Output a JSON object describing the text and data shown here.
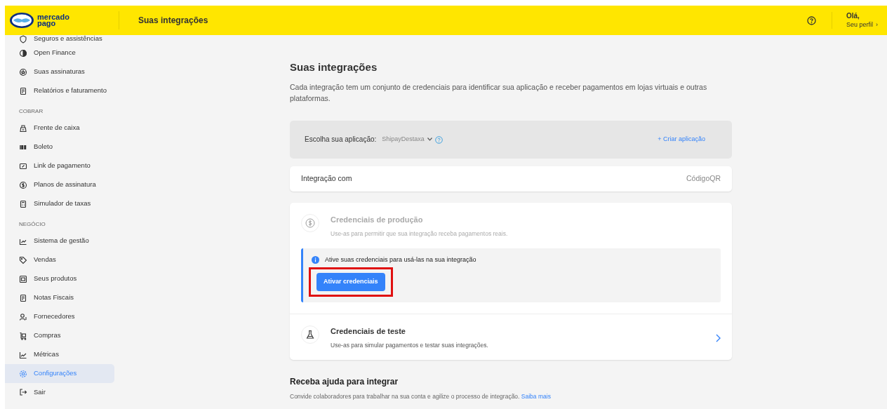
{
  "header": {
    "logo_line1": "mercado",
    "logo_line2": "pago",
    "title": "Suas integrações",
    "greeting": "Olá,",
    "profile_link": "Seu perfil",
    "profile_chevron": "›"
  },
  "sidebar": {
    "items": [
      {
        "kind": "item",
        "label": "Seguros e assistências",
        "selected": false
      },
      {
        "kind": "item",
        "label": "Open Finance",
        "selected": false
      },
      {
        "kind": "item",
        "label": "Suas assinaturas",
        "selected": false
      },
      {
        "kind": "item",
        "label": "Relatórios e faturamento",
        "selected": false
      },
      {
        "kind": "section",
        "label": "COBRAR"
      },
      {
        "kind": "item",
        "label": "Frente de caixa",
        "selected": false
      },
      {
        "kind": "item",
        "label": "Boleto",
        "selected": false
      },
      {
        "kind": "item",
        "label": "Link de pagamento",
        "selected": false
      },
      {
        "kind": "item",
        "label": "Planos de assinatura",
        "selected": false
      },
      {
        "kind": "item",
        "label": "Simulador de taxas",
        "selected": false
      },
      {
        "kind": "section",
        "label": "NEGÓCIO"
      },
      {
        "kind": "item",
        "label": "Sistema de gestão",
        "selected": false
      },
      {
        "kind": "item",
        "label": "Vendas",
        "selected": false
      },
      {
        "kind": "item",
        "label": "Seus produtos",
        "selected": false
      },
      {
        "kind": "item",
        "label": "Notas Fiscais",
        "selected": false
      },
      {
        "kind": "item",
        "label": "Fornecedores",
        "selected": false
      },
      {
        "kind": "item",
        "label": "Compras",
        "selected": false
      },
      {
        "kind": "item",
        "label": "Métricas",
        "selected": false
      },
      {
        "kind": "item",
        "label": "Configurações",
        "selected": true
      },
      {
        "kind": "gap"
      },
      {
        "kind": "item",
        "label": "Sair",
        "selected": false
      }
    ]
  },
  "main": {
    "title": "Suas integrações",
    "description": "Cada integração tem um conjunto de credenciais para identificar sua aplicação e receber pagamentos em lojas virtuais e outras plataformas.",
    "app_selector": {
      "label": "Escolha sua aplicação:",
      "value": "ShipayDestaxa",
      "create_link": "+ Criar aplicação"
    },
    "integration": {
      "label": "Integração com",
      "value": "CódigoQR"
    },
    "production": {
      "title": "Credenciais de produção",
      "description": "Use-as para permitir que sua integração receba pagamentos reais.",
      "disabled": true,
      "notice": "Ative suas credenciais para usá-las na sua integração",
      "button": "Ativar credenciais"
    },
    "test": {
      "title": "Credenciais de teste",
      "description": "Use-as para simular pagamentos e testar suas integrações.",
      "disabled": false
    },
    "help": {
      "title": "Receba ajuda para integrar",
      "description": "Convide colaboradores para trabalhar na sua conta e agilize o processo de integração.",
      "link": "Saiba mais"
    }
  }
}
